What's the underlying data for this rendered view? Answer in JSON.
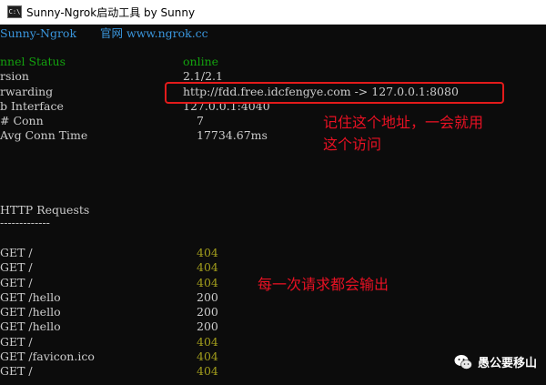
{
  "window": {
    "title": "Sunny-Ngrok启动工具 by Sunny",
    "icon_label": "C:\\"
  },
  "header": {
    "brand": "Sunny-Ngrok",
    "official_site": "官网 www.ngrok.cc"
  },
  "status": [
    {
      "label": "nnel Status",
      "value": "online"
    },
    {
      "label": "rsion",
      "value": "2.1/2.1"
    },
    {
      "label": "rwarding",
      "value": "http://fdd.free.idcfengye.com -> 127.0.0.1:8080"
    },
    {
      "label": "b Interface",
      "value": "127.0.0.1:4040"
    },
    {
      "label": "# Conn",
      "value": "7"
    },
    {
      "label": "Avg Conn Time",
      "value": "17734.67ms"
    }
  ],
  "http": {
    "heading": "HTTP Requests",
    "underline": "-------------",
    "requests": [
      {
        "path": "GET /",
        "code": "404"
      },
      {
        "path": "GET /",
        "code": "404"
      },
      {
        "path": "GET /",
        "code": "404"
      },
      {
        "path": "GET /hello",
        "code": "200"
      },
      {
        "path": "GET /hello",
        "code": "200"
      },
      {
        "path": "GET /hello",
        "code": "200"
      },
      {
        "path": "GET /",
        "code": "404"
      },
      {
        "path": "GET /favicon.ico",
        "code": "404"
      },
      {
        "path": "GET /",
        "code": "404"
      }
    ]
  },
  "annotations": {
    "note1_line1": "记住这个地址，一会就用",
    "note1_line2": "这个访问",
    "note2": "每一次请求都会输出"
  },
  "watermark": {
    "text": "愚公要移山",
    "icon": "wechat-icon"
  },
  "colors": {
    "cyan": "#3a96dd",
    "green": "#13a10e",
    "yellow": "#a39e1c",
    "red": "#e81123"
  }
}
